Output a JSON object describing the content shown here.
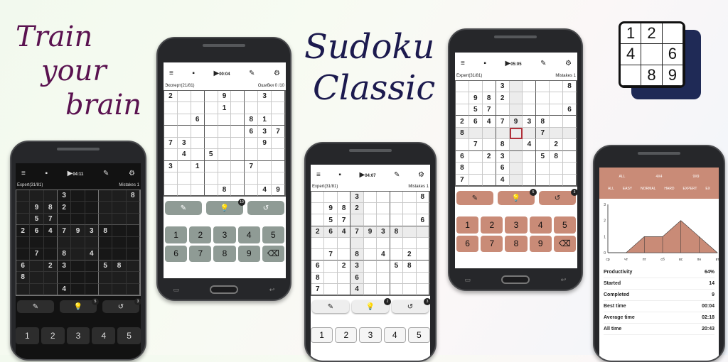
{
  "tagline": [
    "Train",
    "your",
    "brain"
  ],
  "title": [
    "Sudoku",
    "Classic"
  ],
  "logo": [
    "1",
    "2",
    "",
    "4",
    "",
    "6",
    "",
    "8",
    "9"
  ],
  "p1": {
    "time": "04:11",
    "level": "Expert(31/81)",
    "mistakes": "Mistakes 1",
    "hints": "5",
    "undo": "3",
    "grid": [
      [
        "",
        "",
        "",
        "3",
        "",
        "",
        "",
        "",
        "8"
      ],
      [
        "",
        "9",
        "8",
        "2",
        "",
        "",
        "",
        "",
        ""
      ],
      [
        "",
        "5",
        "7",
        "",
        "",
        "",
        "",
        "",
        ""
      ],
      [
        "2",
        "6",
        "4",
        "7",
        "9",
        "3",
        "8",
        "",
        ""
      ],
      [
        "",
        "",
        "",
        "",
        "",
        "",
        "",
        "",
        ""
      ],
      [
        "",
        "7",
        "",
        "8",
        "",
        "4",
        "",
        "",
        ""
      ],
      [
        "6",
        "",
        "2",
        "3",
        "",
        "",
        "5",
        "8",
        ""
      ],
      [
        "8",
        "",
        "",
        "",
        "",
        "",
        "",
        "",
        ""
      ],
      [
        "",
        "",
        "",
        "4",
        "",
        "",
        "",
        "",
        ""
      ]
    ],
    "keys": [
      "1",
      "2",
      "3",
      "4",
      "5"
    ]
  },
  "p2": {
    "time": "00:04",
    "level": "Эксперт(21/81)",
    "mistakes": "Ошибки 0 /10",
    "hints": "10",
    "grid": [
      [
        "2",
        "",
        "",
        "",
        "9",
        "",
        "",
        "3",
        ""
      ],
      [
        "",
        "",
        "",
        "",
        "1",
        "",
        "",
        "",
        ""
      ],
      [
        "",
        "",
        "6",
        "",
        "",
        "",
        "8",
        "1",
        ""
      ],
      [
        "",
        "",
        "",
        "",
        "",
        "",
        "6",
        "3",
        "7"
      ],
      [
        "7",
        "3",
        "",
        "",
        "",
        "",
        "",
        "9",
        ""
      ],
      [
        "",
        "4",
        "",
        "5",
        "",
        "",
        "",
        "",
        ""
      ],
      [
        "3",
        "",
        "1",
        "",
        "",
        "",
        "7",
        "",
        ""
      ],
      [
        "",
        "",
        "",
        "",
        "",
        "",
        "",
        "",
        ""
      ],
      [
        "",
        "",
        "",
        "",
        "8",
        "",
        "",
        "4",
        "9"
      ]
    ],
    "keys": [
      "1",
      "2",
      "3",
      "4",
      "5",
      "6",
      "7",
      "8",
      "9",
      "⌫"
    ]
  },
  "p3": {
    "time": "04:07",
    "level": "Expert(31/81)",
    "mistakes": "Mistakes 1",
    "hints": "2",
    "undo": "3",
    "grid": [
      [
        "",
        "",
        "",
        "3",
        "",
        "",
        "",
        "",
        "8"
      ],
      [
        "",
        "9",
        "8",
        "2",
        "",
        "",
        "",
        "",
        ""
      ],
      [
        "",
        "5",
        "7",
        "",
        "",
        "",
        "",
        "",
        "6"
      ],
      [
        "2",
        "6",
        "4",
        "7",
        "9",
        "3",
        "8",
        "",
        ""
      ],
      [
        "",
        "",
        "",
        "",
        "",
        "",
        "",
        "",
        ""
      ],
      [
        "",
        "7",
        "",
        "8",
        "",
        "4",
        "",
        "2",
        ""
      ],
      [
        "6",
        "",
        "2",
        "3",
        "",
        "",
        "5",
        "8",
        ""
      ],
      [
        "8",
        "",
        "",
        "6",
        "",
        "",
        "",
        "",
        ""
      ],
      [
        "7",
        "",
        "",
        "4",
        "",
        "",
        "",
        "",
        ""
      ]
    ],
    "keys": [
      "1",
      "2",
      "3",
      "4",
      "5"
    ]
  },
  "p4": {
    "time": "05:05",
    "level": "Expert(31/81)",
    "mistakes": "Mistakes 1",
    "hints": "5",
    "undo": "3",
    "grid": [
      [
        "",
        "",
        "",
        "3",
        "",
        "",
        "",
        "",
        "8"
      ],
      [
        "",
        "9",
        "8",
        "2",
        "",
        "",
        "",
        "",
        ""
      ],
      [
        "",
        "5",
        "7",
        "",
        "",
        "",
        "",
        "",
        "6"
      ],
      [
        "2",
        "6",
        "4",
        "7",
        "9",
        "3",
        "8",
        "",
        ""
      ],
      [
        "8",
        "",
        "",
        "",
        "",
        "",
        "7",
        "",
        ""
      ],
      [
        "",
        "7",
        "",
        "8",
        "",
        "4",
        "",
        "2",
        ""
      ],
      [
        "6",
        "",
        "2",
        "3",
        "",
        "",
        "5",
        "8",
        ""
      ],
      [
        "8",
        "",
        "",
        "6",
        "",
        "",
        "",
        "",
        ""
      ],
      [
        "7",
        "",
        "",
        "4",
        "",
        "",
        "",
        "",
        ""
      ]
    ],
    "keys": [
      "1",
      "2",
      "3",
      "4",
      "5",
      "6",
      "7",
      "8",
      "9",
      "⌫"
    ]
  },
  "p5": {
    "tabs": [
      "ALL",
      "4X4",
      "9X9"
    ],
    "levels": [
      "ALL",
      "EASY",
      "NORMAL",
      "HARD",
      "EXPERT",
      "EX"
    ],
    "days": [
      "ср",
      "чт",
      "пт",
      "сб",
      "вс",
      "пн",
      "вт"
    ],
    "chart_data": {
      "type": "area",
      "x": [
        "ср",
        "чт",
        "пт",
        "сб",
        "вс",
        "пн",
        "вт"
      ],
      "values": [
        0,
        0,
        1,
        1,
        2,
        1,
        0
      ],
      "ylim": [
        0,
        3
      ],
      "yticks": [
        "0",
        "1",
        "2",
        "3"
      ]
    },
    "stats": [
      [
        "Productivity",
        "64%"
      ],
      [
        "Started",
        "14"
      ],
      [
        "Completed",
        "9"
      ],
      [
        "Best time",
        "00:04"
      ],
      [
        "Average time",
        "02:18"
      ],
      [
        "All time",
        "20:43"
      ]
    ]
  },
  "colors": {
    "accent": "#c98b77",
    "green": "#6ccf6c",
    "keyGray": "#8f9b95"
  }
}
